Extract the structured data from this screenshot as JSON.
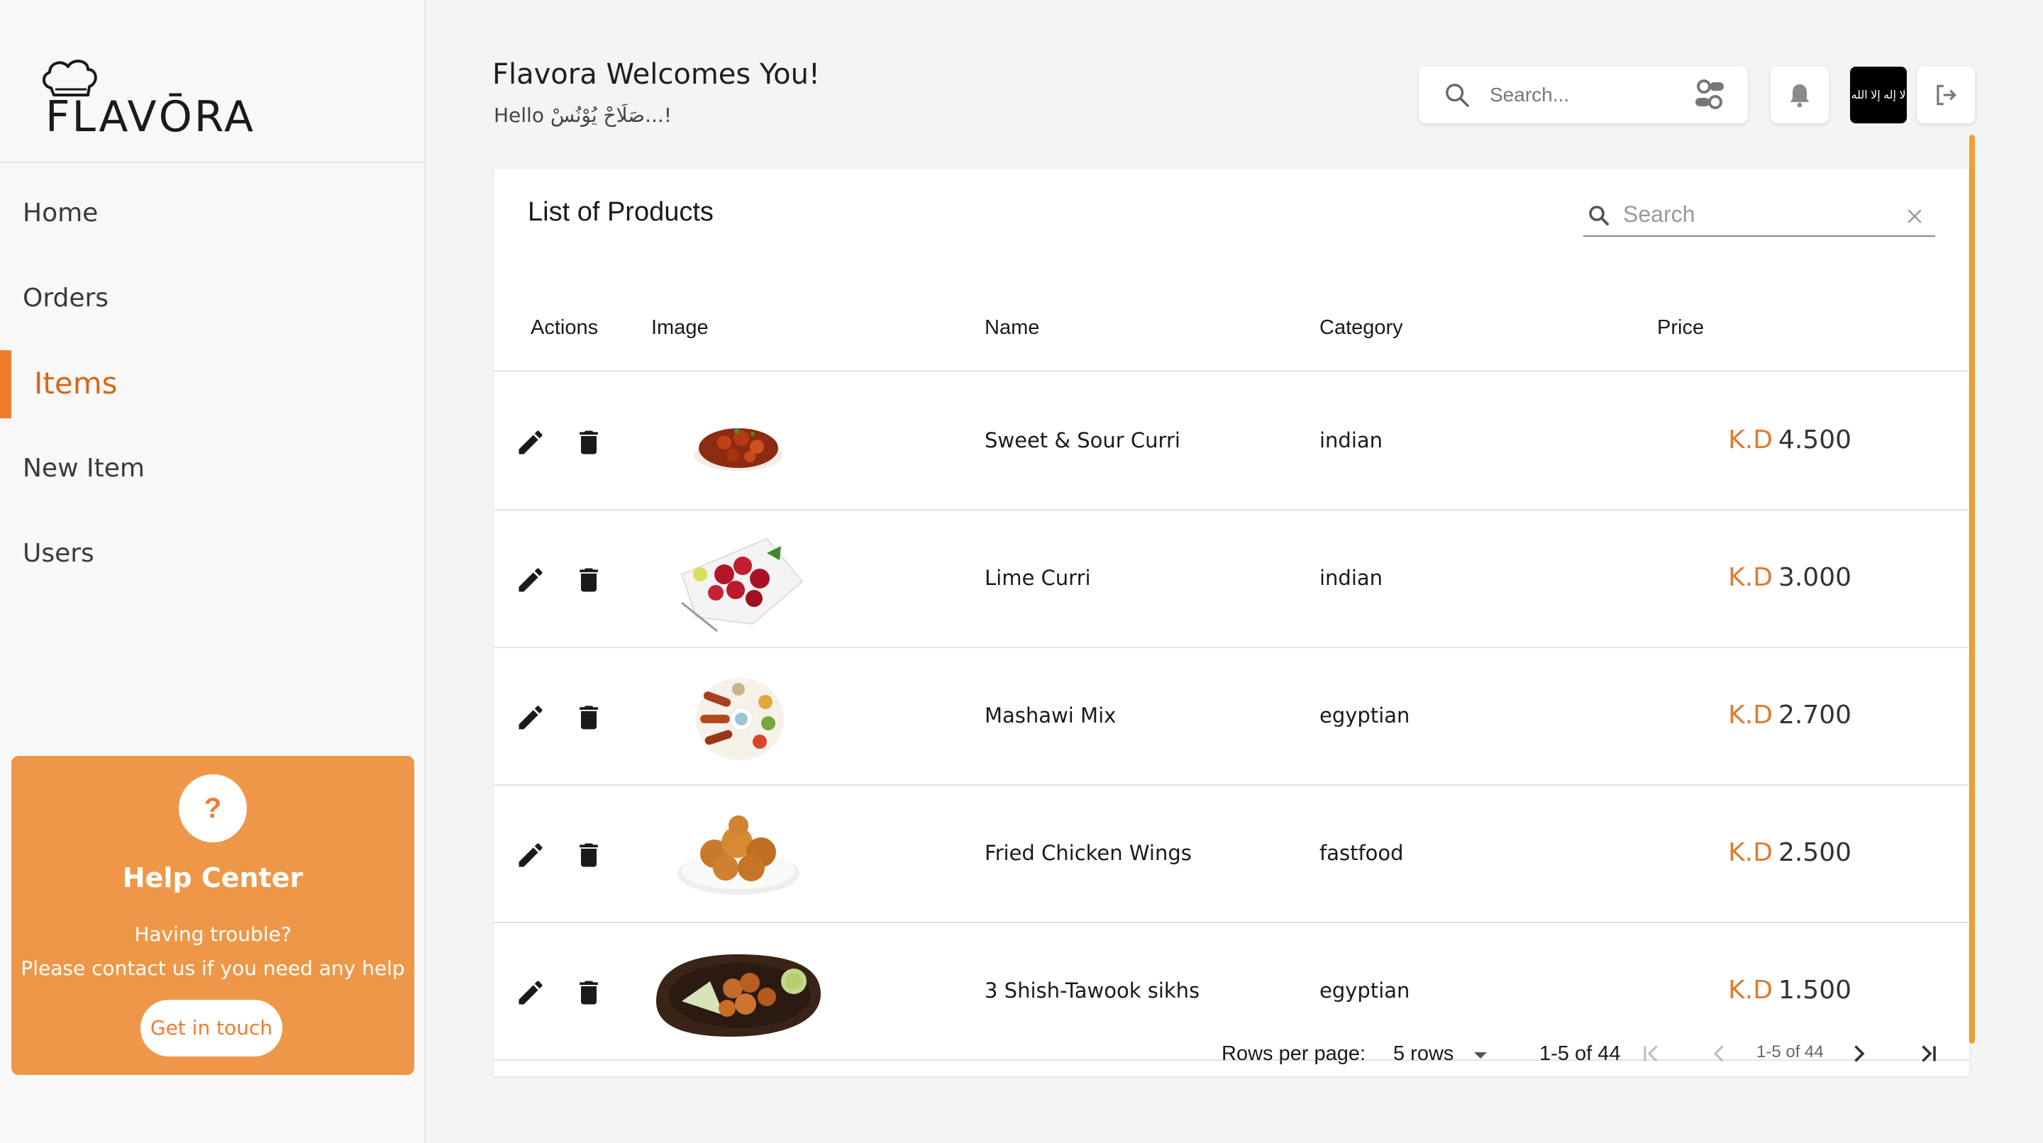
{
  "brand": {
    "name": "FLAVŌRA"
  },
  "sidebar": {
    "items": [
      {
        "label": "Home",
        "active": false
      },
      {
        "label": "Orders",
        "active": false
      },
      {
        "label": "Items",
        "active": true
      },
      {
        "label": "New Item",
        "active": false
      },
      {
        "label": "Users",
        "active": false
      }
    ],
    "help": {
      "icon_char": "?",
      "title": "Help Center",
      "line1": "Having trouble?",
      "line2": "Please contact us if you need any help",
      "button": "Get in touch"
    }
  },
  "header": {
    "welcome": "Flavora Welcomes You!",
    "greeting": "Hello صَلَاحْ يُوْنُسْ...!",
    "search_placeholder": "Search...",
    "avatar_text": "لا إله إلا الله"
  },
  "products": {
    "title": "List of Products",
    "search_placeholder": "Search",
    "columns": [
      "Actions",
      "Image",
      "Name",
      "Category",
      "Price"
    ],
    "currency": "K.D",
    "rows": [
      {
        "name": "Sweet & Sour Curri",
        "category": "indian",
        "price": "4.500",
        "image": "curry-dish"
      },
      {
        "name": "Lime Curri",
        "category": "indian",
        "price": "3.000",
        "image": "red-curry-plate"
      },
      {
        "name": "Mashawi Mix",
        "category": "egyptian",
        "price": "2.700",
        "image": "grill-platter"
      },
      {
        "name": "Fried Chicken Wings",
        "category": "fastfood",
        "price": "2.500",
        "image": "fried-chicken"
      },
      {
        "name": "3 Shish-Tawook sikhs",
        "category": "egyptian",
        "price": "1.500",
        "image": "tawook-skillet"
      }
    ],
    "pagination": {
      "rows_per_page_label": "Rows per page:",
      "rows_per_page_value": "5 rows",
      "range": "1-5 of 44",
      "range_small": "1-5 of 44"
    }
  },
  "colors": {
    "accent": "#ef7c2e",
    "help_bg": "#ef9748",
    "scroll_accent": "#f0a030",
    "price_currency": "#e07a30"
  }
}
